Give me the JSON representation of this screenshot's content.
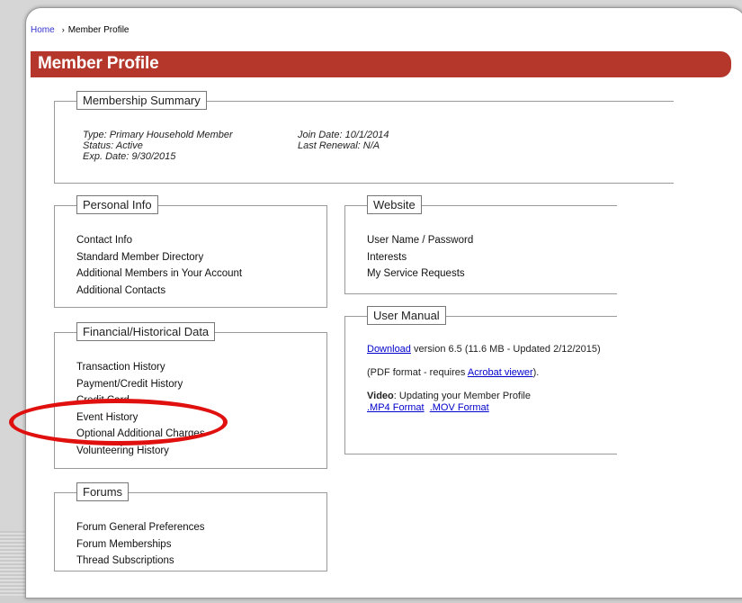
{
  "breadcrumb": {
    "home": "Home",
    "separator": "›",
    "current": "Member Profile"
  },
  "page": {
    "title": "Member Profile"
  },
  "membership_summary": {
    "legend": "Membership Summary",
    "type": "Type: Primary Household Member",
    "status": "Status: Active",
    "exp_date": "Exp. Date: 9/30/2015",
    "join_date": "Join Date: 10/1/2014",
    "last_renewal": "Last Renewal: N/A"
  },
  "personal_info": {
    "legend": "Personal Info",
    "items": [
      "Contact Info",
      "Standard Member Directory",
      "Additional Members in Your Account",
      "Additional Contacts"
    ]
  },
  "website": {
    "legend": "Website",
    "items": [
      "User Name / Password",
      "Interests",
      "My Service Requests"
    ]
  },
  "financial": {
    "legend": "Financial/Historical Data",
    "items": [
      "Transaction History",
      "Payment/Credit History",
      "Credit Card",
      "Event History",
      "Optional Additional Charges",
      "Volunteering History"
    ]
  },
  "user_manual": {
    "legend": "User Manual",
    "download_link": "Download",
    "download_text": " version 6.5 (11.6 MB - Updated 2/12/2015)",
    "pdf_prefix": "(PDF format - requires ",
    "acrobat_link": "Acrobat viewer",
    "pdf_suffix": ").",
    "video_label": "Video",
    "video_text": ": Updating your Member Profile",
    "mp4_link": ".MP4 Format",
    "mov_link": ".MOV Format"
  },
  "forums": {
    "legend": "Forums",
    "items": [
      "Forum General Preferences",
      "Forum Memberships",
      "Thread Subscriptions"
    ]
  },
  "colors": {
    "title_bar": "#b5372b",
    "link": "#0000cc",
    "highlight_ellipse": "#e0100f"
  }
}
